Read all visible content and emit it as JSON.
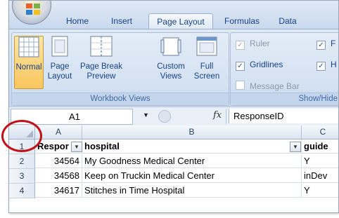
{
  "ribbon": {
    "tabs": [
      {
        "label": "Home"
      },
      {
        "label": "Insert"
      },
      {
        "label": "Page Layout"
      },
      {
        "label": "Formulas"
      },
      {
        "label": "Data"
      }
    ],
    "workbook_views": {
      "label": "Workbook Views",
      "normal": "Normal",
      "page_layout_1": "Page",
      "page_layout_2": "Layout",
      "page_break_1": "Page Break",
      "page_break_2": "Preview",
      "custom_1": "Custom",
      "custom_2": "Views",
      "full_1": "Full",
      "full_2": "Screen"
    },
    "show_hide": {
      "label": "Show/Hide",
      "ruler": "Ruler",
      "gridlines": "Gridlines",
      "message_bar": "Message Bar",
      "f_partial": "F",
      "h_partial": "H"
    }
  },
  "formula_bar": {
    "name_box": "A1",
    "fx": "fx",
    "value": "ResponseID"
  },
  "grid": {
    "columns": [
      "A",
      "B",
      "C"
    ],
    "rows": [
      {
        "n": "1",
        "a": "Respor",
        "b": "hospital",
        "c": "guide"
      },
      {
        "n": "2",
        "a": "34564",
        "b": "My Goodness Medical Center",
        "c": "Y"
      },
      {
        "n": "3",
        "a": "34568",
        "b": "Keep on Truckin Medical Center",
        "c": "inDev"
      },
      {
        "n": "4",
        "a": "34617",
        "b": "Stitches in Time Hospital",
        "c": "Y"
      }
    ]
  },
  "colors": {
    "ribbon_text": "#15428b",
    "highlight_circle": "#c21016",
    "selected_button": "#f9c55e"
  }
}
